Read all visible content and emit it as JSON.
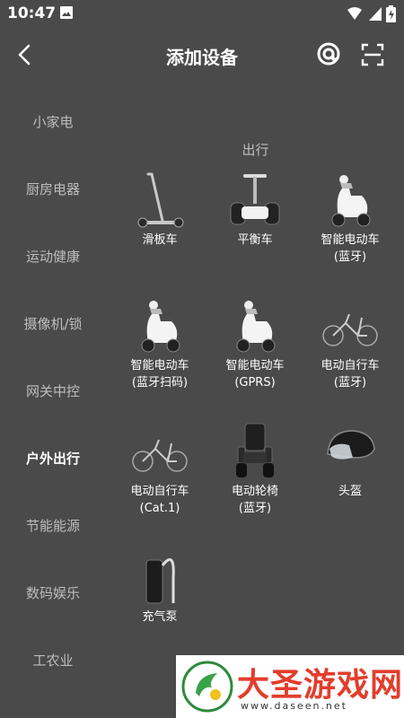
{
  "status": {
    "time": "10:47"
  },
  "header": {
    "title": "添加设备"
  },
  "sidebar": {
    "items": [
      {
        "label": "小家电",
        "active": false
      },
      {
        "label": "厨房电器",
        "active": false
      },
      {
        "label": "运动健康",
        "active": false
      },
      {
        "label": "摄像机/锁",
        "active": false
      },
      {
        "label": "网关中控",
        "active": false
      },
      {
        "label": "户外出行",
        "active": true
      },
      {
        "label": "节能能源",
        "active": false
      },
      {
        "label": "数码娱乐",
        "active": false
      },
      {
        "label": "工农业",
        "active": false
      }
    ]
  },
  "section": {
    "title": "出行"
  },
  "devices": [
    {
      "label": "滑板车",
      "icon": "scooter-icon"
    },
    {
      "label": "平衡车",
      "icon": "balance-car-icon"
    },
    {
      "label": "智能电动车\n(蓝牙)",
      "icon": "e-moped-icon"
    },
    {
      "label": "智能电动车\n(蓝牙扫码)",
      "icon": "e-moped-icon"
    },
    {
      "label": "智能电动车\n(GPRS)",
      "icon": "e-moped-icon"
    },
    {
      "label": "电动自行车\n(蓝牙)",
      "icon": "e-bike-icon"
    },
    {
      "label": "电动自行车\n(Cat.1)",
      "icon": "e-bike-icon"
    },
    {
      "label": "电动轮椅\n(蓝牙)",
      "icon": "wheelchair-icon"
    },
    {
      "label": "头盔",
      "icon": "helmet-icon"
    },
    {
      "label": "充气泵",
      "icon": "air-pump-icon"
    }
  ],
  "watermark": {
    "title": "大圣游戏网",
    "url": "www.daseen.net"
  },
  "colors": {
    "background": "#4a4a4a",
    "text": "#ffffff",
    "muted": "#bdbdbd",
    "watermark_red": "#e23d2c"
  }
}
